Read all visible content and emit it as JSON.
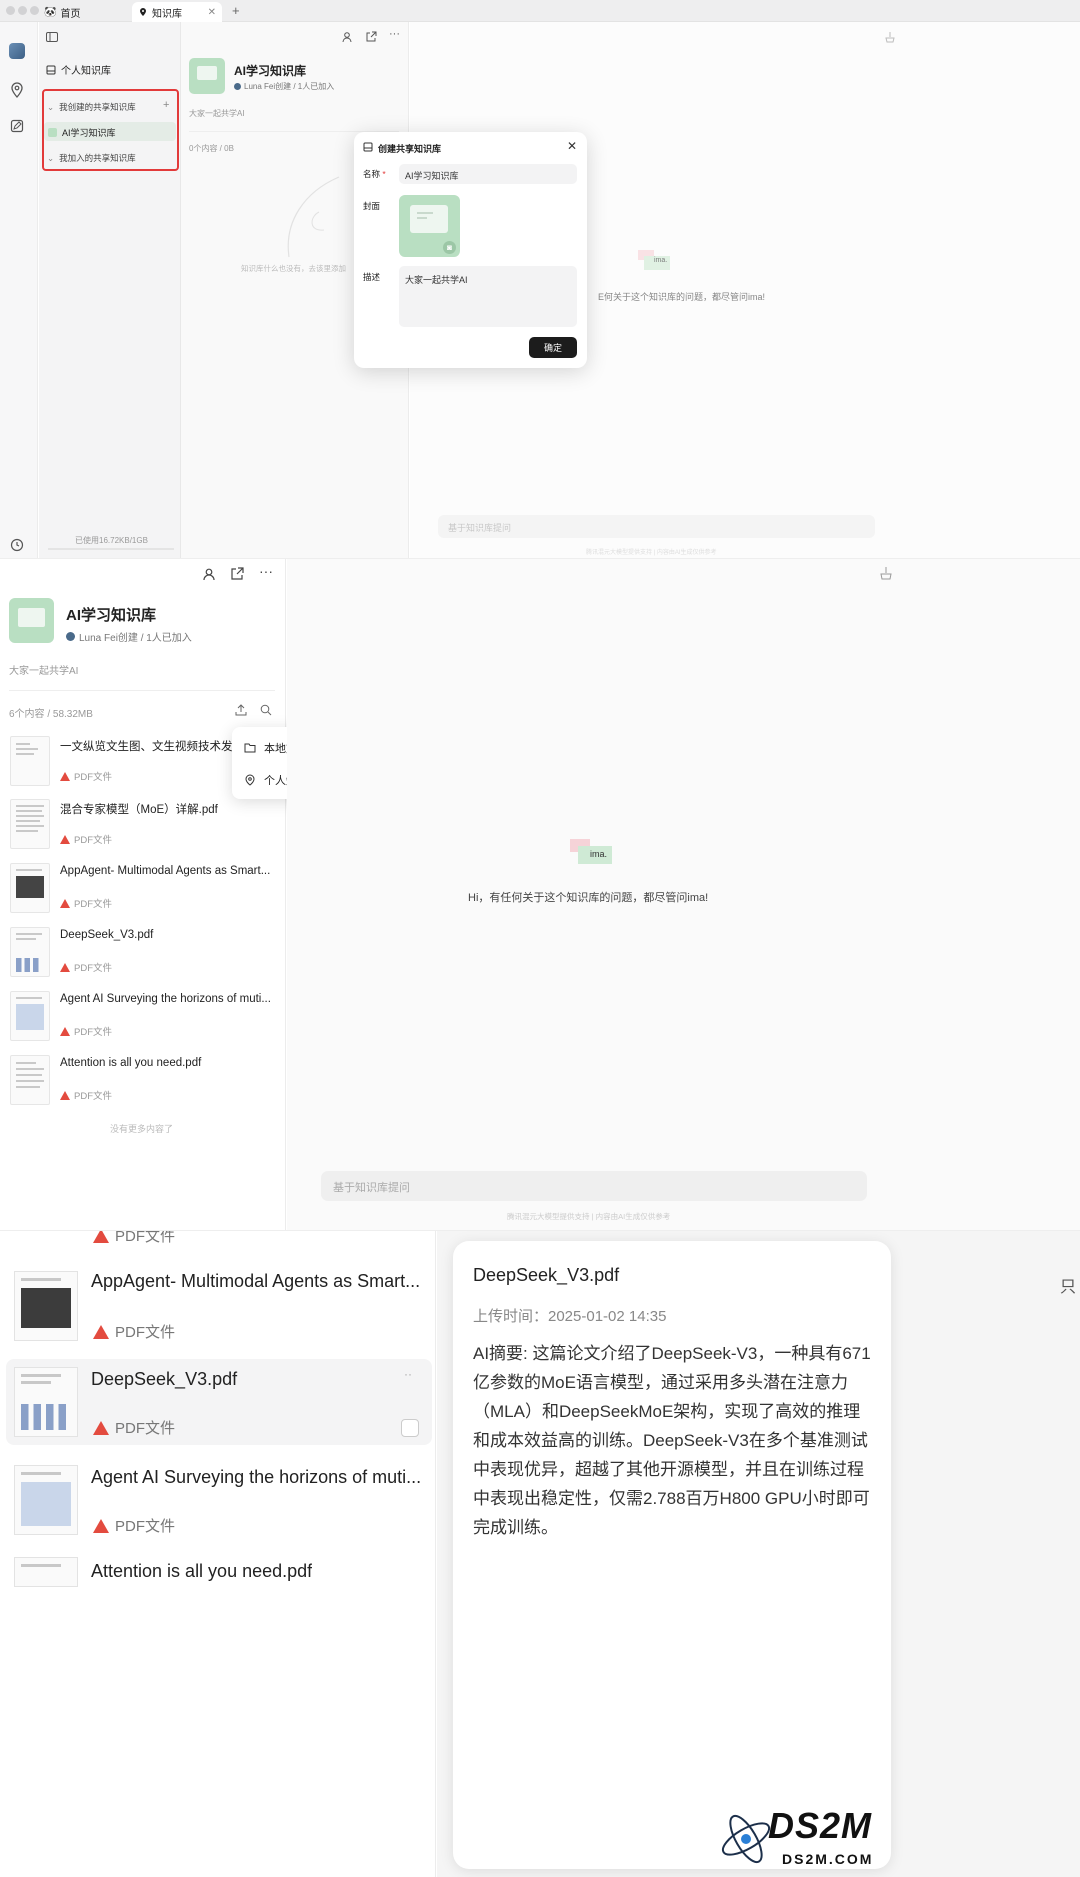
{
  "panel1": {
    "tabs": [
      {
        "label": "首页",
        "icon": "panda-icon"
      },
      {
        "label": "知识库",
        "icon": "location-pin-icon"
      }
    ],
    "sidebar": {
      "personal_kb": "个人知识库",
      "my_shared": "我创建的共享知识库",
      "selected_kb": "AI学习知识库",
      "joined_shared": "我加入的共享知识库",
      "storage": "已使用16.72KB/1GB"
    },
    "kb": {
      "title": "AI学习知识库",
      "creator": "Luna Fei创建 / 1人已加入",
      "description": "大家一起共学AI",
      "count": "0个内容 / 0B",
      "empty_text": "知识库什么也没有，去该里添加"
    },
    "dialog": {
      "title": "创建共享知识库",
      "name_label": "名称",
      "name_value": "AI学习知识库",
      "cover_label": "封面",
      "desc_label": "描述",
      "desc_value": "大家一起共学AI",
      "confirm": "确定"
    },
    "chat": {
      "logo_text": "ima.",
      "greeting_partial": "E何关于这个知识库的问题，都尽管问ima!",
      "input_placeholder": "基于知识库提问",
      "disclaimer": "腾讯混元大模型提供支持 | 内容由AI生成仅供参考"
    }
  },
  "panel2": {
    "kb": {
      "title": "AI学习知识库",
      "creator": "Luna Fei创建 / 1人已加入",
      "description": "大家一起共学AI",
      "count": "6个内容 / 58.32MB"
    },
    "files": [
      {
        "name": "一文纵览文生图、文生视频技术发展",
        "type": "PDF文件"
      },
      {
        "name": "混合专家模型（MoE）详解.pdf",
        "type": "PDF文件"
      },
      {
        "name": "AppAgent- Multimodal Agents as Smart...",
        "type": "PDF文件"
      },
      {
        "name": "DeepSeek_V3.pdf",
        "type": "PDF文件"
      },
      {
        "name": "Agent AI Surveying the horizons of muti...",
        "type": "PDF文件"
      },
      {
        "name": "Attention is all you need.pdf",
        "type": "PDF文件"
      }
    ],
    "no_more": "没有更多内容了",
    "menu": [
      {
        "label": "本地文件",
        "icon": "folder-icon"
      },
      {
        "label": "个人知识库",
        "icon": "location-pin-icon"
      }
    ],
    "chat": {
      "logo_text": "ima.",
      "greeting": "Hi，有任何关于这个知识库的问题，都尽管问ima!",
      "input_placeholder": "基于知识库提问",
      "disclaimer": "腾讯混元大模型提供支持 | 内容由AI生成仅供参考"
    }
  },
  "panel3": {
    "top_partial_type": "PDF文件",
    "files": [
      {
        "name": "AppAgent- Multimodal Agents as Smart...",
        "type": "PDF文件"
      },
      {
        "name": "DeepSeek_V3.pdf",
        "type": "PDF文件"
      },
      {
        "name": "Agent AI Surveying the horizons of muti...",
        "type": "PDF文件"
      },
      {
        "name": "Attention is all you need.pdf",
        "type": ""
      }
    ],
    "more_glyph": "··",
    "detail": {
      "title": "DeepSeek_V3.pdf",
      "upload_time": "上传时间：2025-01-02 14:35",
      "summary": "AI摘要: 这篇论文介绍了DeepSeek-V3，一种具有671亿参数的MoE语言模型，通过采用多头潜在注意力（MLA）和DeepSeekMoE架构，实现了高效的推理和成本效益高的训练。DeepSeek-V3在多个基准测试中表现优异，超越了其他开源模型，并且在训练过程中表现出稳定性，仅需2.788百万H800 GPU小时即可完成训练。"
    },
    "edge_char": "只",
    "watermark": {
      "main": "DS2M",
      "sub": "DS2M.COM"
    }
  },
  "colors": {
    "accent_green": "#b9dfc2",
    "highlight_red": "#e23a3a",
    "pdf_red": "#e34b3f",
    "button_dark": "#1c1c1c"
  }
}
